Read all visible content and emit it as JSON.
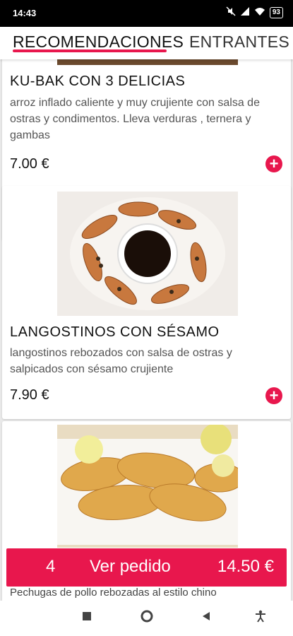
{
  "status_bar": {
    "time": "14:43",
    "battery": "93"
  },
  "tabs": [
    {
      "label": "RECOMENDACIONES",
      "active": true
    },
    {
      "label": "ENTRANTES",
      "active": false
    }
  ],
  "products": [
    {
      "title": "KU-BAK CON 3 DELICIAS",
      "description": "arroz inflado caliente y muy crujiente con salsa de ostras y condimentos. Lleva verduras , ternera y gambas",
      "price": "7.00 €"
    },
    {
      "title": "LANGOSTINOS CON SÉSAMO",
      "description": "langostinos rebozados con salsa de ostras y salpicados con sésamo crujiente",
      "price": "7.90 €"
    },
    {
      "title": "",
      "description": "Pechugas de pollo rebozadas al estilo chino",
      "price": ""
    }
  ],
  "cart": {
    "count": "4",
    "label": "Ver pedido",
    "total": "14.50 €"
  },
  "colors": {
    "accent": "#e8174d"
  },
  "icons": [
    "add-icon",
    "wifi-icon",
    "signal-icon",
    "battery-icon",
    "mute-icon",
    "home-icon",
    "back-icon",
    "recents-icon",
    "accessibility-icon"
  ]
}
